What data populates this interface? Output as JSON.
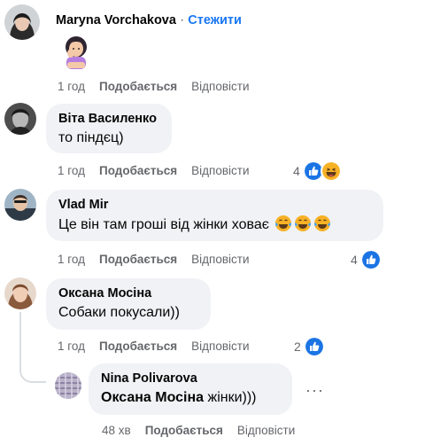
{
  "comments": [
    {
      "author": "Maryna Vorchakova",
      "follow_label": "Стежити",
      "text": "",
      "time": "1 год",
      "like_label": "Подобається",
      "reply_label": "Відповісти"
    },
    {
      "author": "Віта Василенко",
      "text": "то піндєц)",
      "time": "1 год",
      "like_label": "Подобається",
      "reply_label": "Відповісти",
      "reaction_count": "4"
    },
    {
      "author": "Vlad Mir",
      "text": "Це він там гроші від жінки ховає",
      "time": "1 год",
      "like_label": "Подобається",
      "reply_label": "Відповісти",
      "reaction_count": "4"
    },
    {
      "author": "Оксана Мосіна",
      "text": "Собаки покусали))",
      "time": "1 год",
      "like_label": "Подобається",
      "reply_label": "Відповісти",
      "reaction_count": "2"
    }
  ],
  "reply": {
    "author": "Nina Polivarova",
    "mention": "Оксана Мосіна",
    "text": " жінки)))",
    "time": "48 хв",
    "like_label": "Подобається",
    "reply_label": "Відповісти",
    "more_label": "···"
  },
  "colors": {
    "accent": "#1877f2",
    "bubble": "#f0f2f5",
    "meta_text": "#65676b",
    "like_reaction": "#1b74e4",
    "haha_reaction": "#f7b125"
  }
}
